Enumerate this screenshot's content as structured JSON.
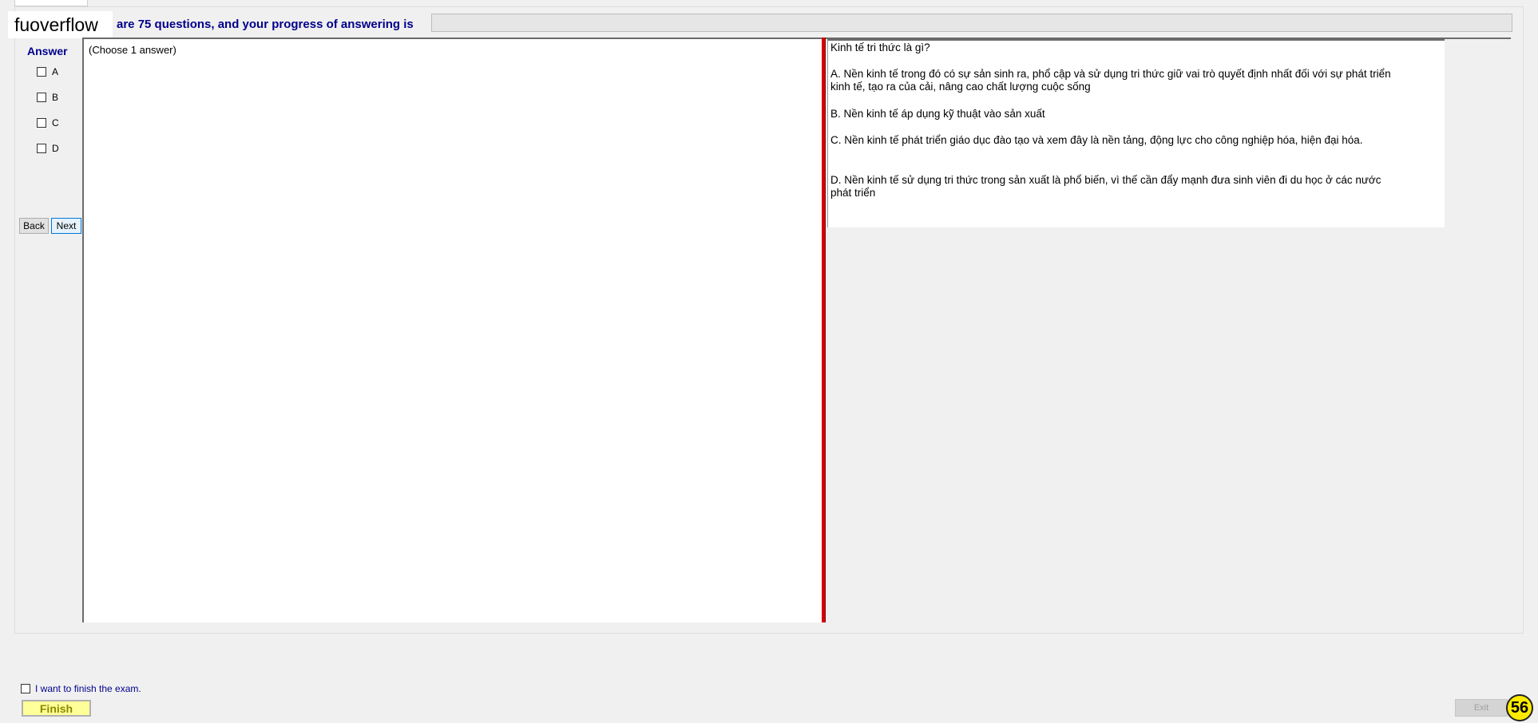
{
  "brand": "fuoverflow",
  "header": {
    "progress_text": "are 75 questions, and your progress of answering is",
    "progress_fraction": 0.0
  },
  "answer": {
    "title": "Answer",
    "options": [
      "A",
      "B",
      "C",
      "D"
    ],
    "back_label": "Back",
    "next_label": "Next"
  },
  "left_panel": {
    "hint": "(Choose 1 answer)"
  },
  "question": {
    "prompt": "Kinh tế tri thức là gì?",
    "choices": [
      "A.  Nền kinh tế trong đó có sự sản sinh ra, phổ cập và sử dụng tri thức giữ vai trò quyết định nhất đối với sự phát triển kinh tế, tạo ra của cải, nâng cao chất lượng cuộc sống",
      "B.  Nền kinh tế áp dụng kỹ thuật vào sản xuất",
      "C.  Nền kinh tế phát triển giáo dục đào tạo và xem đây là nền tảng, động lực cho công nghiệp hóa, hiện đại hóa.",
      "D.  Nền kinh tế sử dụng tri thức trong sản xuất là phổ biến, vì thế cần đẩy mạnh đưa sinh viên đi du học ở các nước phát triển"
    ]
  },
  "footer": {
    "finish_checkbox_label": "I want to finish the exam.",
    "finish_label": "Finish",
    "exit_label": "Exit",
    "badge": "56"
  },
  "colors": {
    "accent_text": "#00008b",
    "splitter": "#d40000",
    "finish_bg": "#ffff99",
    "badge_bg": "#ffeb00"
  }
}
